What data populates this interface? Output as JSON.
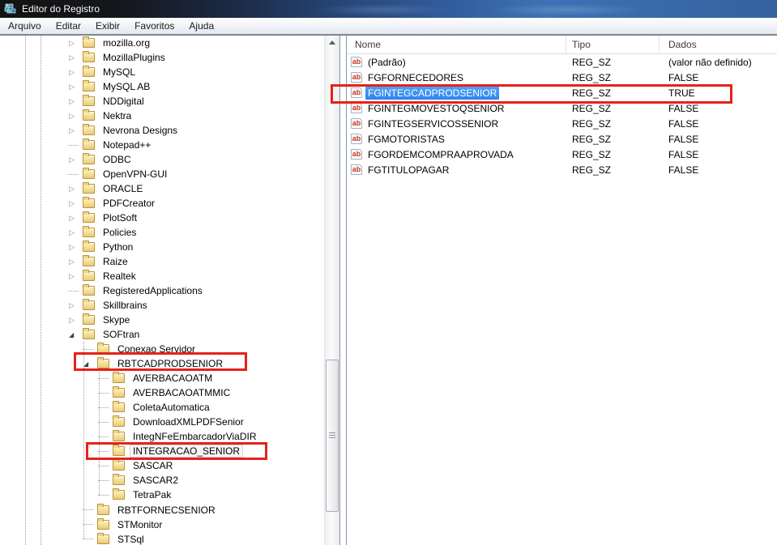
{
  "window": {
    "title": "Editor do Registro"
  },
  "menu": {
    "items": [
      "Arquivo",
      "Editar",
      "Exibir",
      "Favoritos",
      "Ajuda"
    ]
  },
  "icons": {
    "reg_sz": "ab",
    "expand_collapsed": "▷",
    "expand_expanded": "◢",
    "window_icon": "registry-cubes"
  },
  "colors": {
    "annotation_red": "#e5221a",
    "selection_blue": "#2c86ec",
    "titlebar_blue": "#3e71b4"
  },
  "tree": {
    "items": [
      {
        "label": "mozilla.org",
        "level": 0,
        "state": "collapsed"
      },
      {
        "label": "MozillaPlugins",
        "level": 0,
        "state": "collapsed"
      },
      {
        "label": "MySQL",
        "level": 0,
        "state": "collapsed"
      },
      {
        "label": "MySQL AB",
        "level": 0,
        "state": "collapsed"
      },
      {
        "label": "NDDigital",
        "level": 0,
        "state": "collapsed"
      },
      {
        "label": "Nektra",
        "level": 0,
        "state": "collapsed"
      },
      {
        "label": "Nevrona Designs",
        "level": 0,
        "state": "collapsed"
      },
      {
        "label": "Notepad++",
        "level": 0,
        "state": "leaf"
      },
      {
        "label": "ODBC",
        "level": 0,
        "state": "collapsed"
      },
      {
        "label": "OpenVPN-GUI",
        "level": 0,
        "state": "leaf"
      },
      {
        "label": "ORACLE",
        "level": 0,
        "state": "collapsed"
      },
      {
        "label": "PDFCreator",
        "level": 0,
        "state": "collapsed"
      },
      {
        "label": "PlotSoft",
        "level": 0,
        "state": "collapsed"
      },
      {
        "label": "Policies",
        "level": 0,
        "state": "collapsed"
      },
      {
        "label": "Python",
        "level": 0,
        "state": "collapsed"
      },
      {
        "label": "Raize",
        "level": 0,
        "state": "collapsed"
      },
      {
        "label": "Realtek",
        "level": 0,
        "state": "collapsed"
      },
      {
        "label": "RegisteredApplications",
        "level": 0,
        "state": "leaf"
      },
      {
        "label": "Skillbrains",
        "level": 0,
        "state": "collapsed"
      },
      {
        "label": "Skype",
        "level": 0,
        "state": "collapsed"
      },
      {
        "label": "SOFtran",
        "level": 0,
        "state": "expanded"
      },
      {
        "label": "Conexao Servidor",
        "level": 1,
        "state": "leaf"
      },
      {
        "label": "RBTCADPRODSENIOR",
        "level": 1,
        "state": "expanded",
        "annotated": true
      },
      {
        "label": "AVERBACAOATM",
        "level": 2,
        "state": "leaf"
      },
      {
        "label": "AVERBACAOATMMIC",
        "level": 2,
        "state": "leaf"
      },
      {
        "label": "ColetaAutomatica",
        "level": 2,
        "state": "leaf"
      },
      {
        "label": "DownloadXMLPDFSenior",
        "level": 2,
        "state": "leaf"
      },
      {
        "label": "IntegNFeEmbarcadorViaDIR",
        "level": 2,
        "state": "leaf"
      },
      {
        "label": "INTEGRACAO_SENIOR",
        "level": 2,
        "state": "leaf",
        "selected": true,
        "annotated": true
      },
      {
        "label": "SASCAR",
        "level": 2,
        "state": "leaf"
      },
      {
        "label": "SASCAR2",
        "level": 2,
        "state": "leaf"
      },
      {
        "label": "TetraPak",
        "level": 2,
        "state": "leaf"
      },
      {
        "label": "RBTFORNECSENIOR",
        "level": 1,
        "state": "leaf"
      },
      {
        "label": "STMonitor",
        "level": 1,
        "state": "leaf"
      },
      {
        "label": "STSql",
        "level": 1,
        "state": "leaf"
      }
    ]
  },
  "list": {
    "columns": [
      "Nome",
      "Tipo",
      "Dados"
    ],
    "rows": [
      {
        "name": "(Padrão)",
        "type": "REG_SZ",
        "data": "(valor não definido)"
      },
      {
        "name": "FGFORNECEDORES",
        "type": "REG_SZ",
        "data": "FALSE"
      },
      {
        "name": "FGINTEGCADPRODSENIOR",
        "type": "REG_SZ",
        "data": "TRUE",
        "selected": true,
        "annotated": true
      },
      {
        "name": "FGINTEGMOVESTOQSENIOR",
        "type": "REG_SZ",
        "data": "FALSE"
      },
      {
        "name": "FGINTEGSERVICOSSENIOR",
        "type": "REG_SZ",
        "data": "FALSE"
      },
      {
        "name": "FGMOTORISTAS",
        "type": "REG_SZ",
        "data": "FALSE"
      },
      {
        "name": "FGORDEMCOMPRAAPROVADA",
        "type": "REG_SZ",
        "data": "FALSE"
      },
      {
        "name": "FGTITULOPAGAR",
        "type": "REG_SZ",
        "data": "FALSE"
      }
    ]
  }
}
